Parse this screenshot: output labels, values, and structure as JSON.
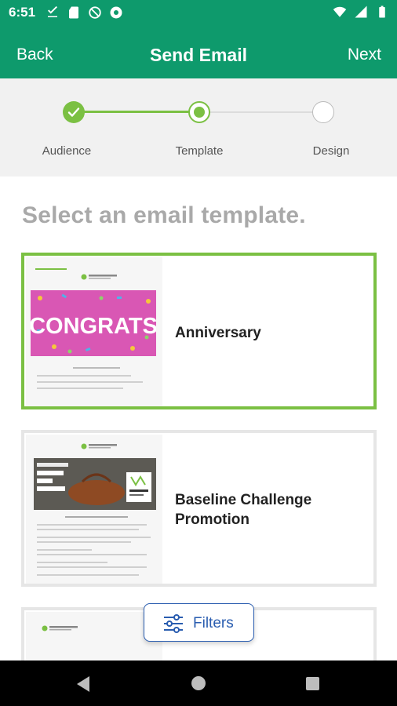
{
  "status_bar": {
    "time": "6:51",
    "left_icons": [
      "download-done-icon",
      "sd-card-icon",
      "no-sync-icon",
      "chrome-icon"
    ],
    "right_icons": [
      "wifi-icon",
      "signal-icon",
      "battery-icon"
    ]
  },
  "app_bar": {
    "back_label": "Back",
    "title": "Send Email",
    "next_label": "Next"
  },
  "stepper": {
    "steps": [
      {
        "label": "Audience",
        "state": "complete"
      },
      {
        "label": "Template",
        "state": "active"
      },
      {
        "label": "Design",
        "state": "pending"
      }
    ]
  },
  "heading": "Select an email template.",
  "templates": [
    {
      "title": "Anniversary",
      "selected": true,
      "banner_text": "CONGRATS"
    },
    {
      "title_line1": "Baseline Challenge",
      "title_line2": "Promotion",
      "selected": false,
      "banner_text": "Build on Your Success This Summer!"
    },
    {
      "title": "",
      "selected": false
    }
  ],
  "filters": {
    "label": "Filters"
  },
  "colors": {
    "brand_green": "#0e9a6c",
    "selected_border": "#7bc043",
    "filters_blue": "#2a5db0",
    "heading_gray": "#a9a9a9"
  }
}
